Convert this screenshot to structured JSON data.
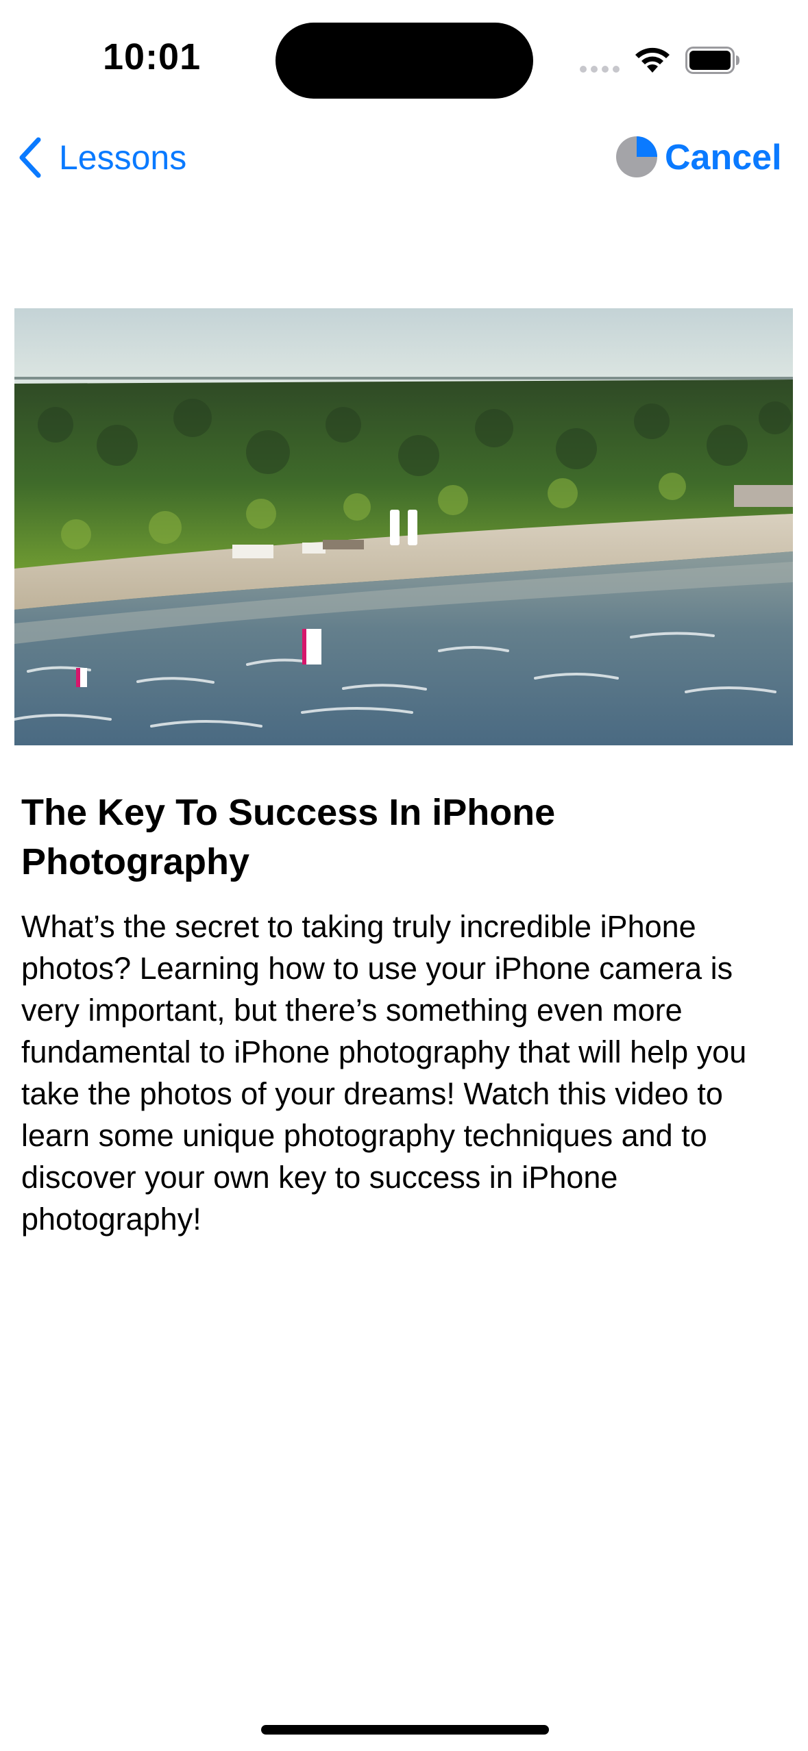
{
  "status_bar": {
    "time": "10:01",
    "icons": [
      "cellular-signal-icon",
      "wifi-icon",
      "battery-icon"
    ]
  },
  "nav": {
    "back_label": "Lessons",
    "cancel_label": "Cancel",
    "download_progress": 0.25,
    "accent_color": "#0a7aff"
  },
  "video": {
    "state": "playing",
    "control_icon": "pause-icon"
  },
  "lesson": {
    "title": "The Key To Success In iPhone Photography",
    "description": "What’s the secret to taking truly incredible iPhone photos? Learning how to use your iPhone camera is very important, but there’s something even more fundamental to iPhone photography that will help you take the photos of your dreams! Watch this video to learn some unique photography techniques and to discover your own key to success in iPhone photography!"
  }
}
